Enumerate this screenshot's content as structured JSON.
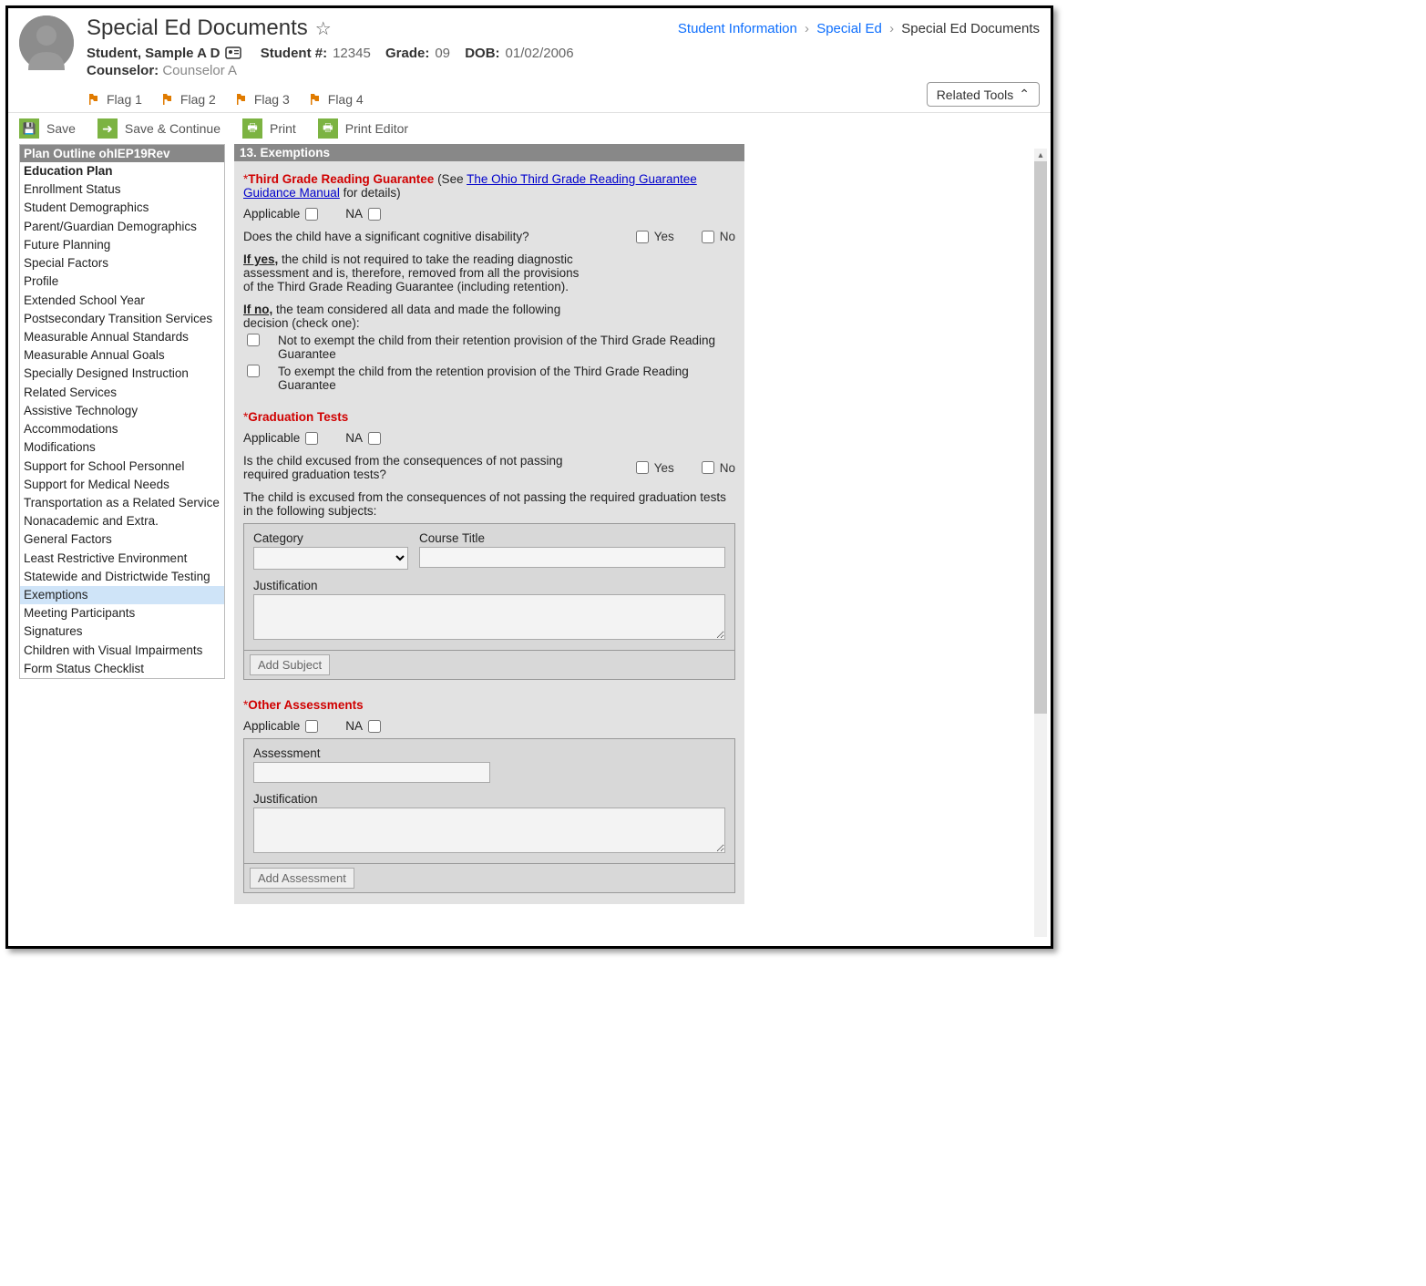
{
  "page": {
    "title": "Special Ed Documents",
    "breadcrumb": {
      "a": "Student Information",
      "b": "Special Ed",
      "c": "Special Ed Documents"
    }
  },
  "student": {
    "name": "Student, Sample A D",
    "number_label": "Student #:",
    "number": "12345",
    "grade_label": "Grade:",
    "grade": "09",
    "dob_label": "DOB:",
    "dob": "01/02/2006",
    "counselor_label": "Counselor:",
    "counselor": "Counselor A"
  },
  "flags": [
    "Flag 1",
    "Flag 2",
    "Flag 3",
    "Flag 4"
  ],
  "related_tools": "Related Tools",
  "toolbar": {
    "save": "Save",
    "save_continue": "Save & Continue",
    "print": "Print",
    "print_editor": "Print Editor"
  },
  "sidebar": {
    "header": "Plan Outline ohIEP19Rev",
    "items": [
      "Education Plan",
      "Enrollment Status",
      "Student Demographics",
      "Parent/Guardian Demographics",
      "Future Planning",
      "Special Factors",
      "Profile",
      "Extended School Year",
      "Postsecondary Transition Services",
      "Measurable Annual Standards",
      "Measurable Annual Goals",
      "Specially Designed Instruction",
      "Related Services",
      "Assistive Technology",
      "Accommodations",
      "Modifications",
      "Support for School Personnel",
      "Support for Medical Needs",
      "Transportation as a Related Service",
      "Nonacademic and Extra.",
      "General Factors",
      "Least Restrictive Environment",
      "Statewide and Districtwide Testing",
      "Exemptions",
      "Meeting Participants",
      "Signatures",
      "Children with Visual Impairments",
      "Form Status Checklist"
    ],
    "selected": "Exemptions"
  },
  "section": {
    "title": "13. Exemptions"
  },
  "tgrg": {
    "title": "Third Grade Reading Guarantee",
    "see": " (See ",
    "link": "The Ohio Third Grade Reading Guarantee Guidance Manual",
    "for_details": " for details)",
    "applicable": "Applicable",
    "na": "NA",
    "q_sig": "Does the child have a significant cognitive disability?",
    "yes": "Yes",
    "no": "No",
    "if_yes": "If yes,",
    "if_yes_text": " the child is not required to take the reading diagnostic assessment and is, therefore, removed from all the provisions of the Third Grade Reading Guarantee (including retention).",
    "if_no": "If no,",
    "if_no_text": " the team considered all data and made the following decision (check one):",
    "opt1": "Not to exempt the child from their retention provision of the Third Grade Reading Guarantee",
    "opt2": "To exempt the child from the retention provision of the Third Grade Reading Guarantee"
  },
  "grad": {
    "title": "Graduation Tests",
    "applicable": "Applicable",
    "na": "NA",
    "q": "Is the child excused from the consequences of not passing required graduation tests?",
    "yes": "Yes",
    "no": "No",
    "excused_text": "The child is excused from the consequences of not passing the required graduation tests in the following subjects:",
    "category": "Category",
    "course_title": "Course Title",
    "justification": "Justification",
    "add_subject": "Add Subject"
  },
  "other": {
    "title": "Other Assessments",
    "applicable": "Applicable",
    "na": "NA",
    "assessment": "Assessment",
    "justification": "Justification",
    "add_assessment": "Add Assessment"
  }
}
